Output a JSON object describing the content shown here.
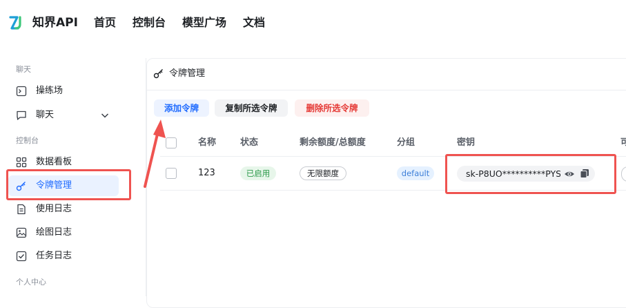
{
  "header": {
    "brand": "知界API",
    "nav": [
      "首页",
      "控制台",
      "模型广场",
      "文档"
    ]
  },
  "sidebar": {
    "sections": [
      {
        "label": "聊天"
      },
      {
        "label": "控制台"
      },
      {
        "label": "个人中心"
      }
    ],
    "items": [
      {
        "label": "操练场",
        "icon": "terminal-icon"
      },
      {
        "label": "聊天",
        "icon": "chat-icon"
      },
      {
        "label": "数据看板",
        "icon": "dashboard-icon"
      },
      {
        "label": "令牌管理",
        "icon": "key-icon",
        "active": true
      },
      {
        "label": "使用日志",
        "icon": "document-icon"
      },
      {
        "label": "绘图日志",
        "icon": "image-icon"
      },
      {
        "label": "任务日志",
        "icon": "task-check-icon"
      }
    ]
  },
  "page": {
    "title": "令牌管理",
    "actions": {
      "add": "添加令牌",
      "copy_selected": "复制所选令牌",
      "delete_selected": "删除所选令牌"
    },
    "columns": [
      "名称",
      "状态",
      "剩余额度/总额度",
      "分组",
      "密钥",
      "可"
    ],
    "rows": [
      {
        "name": "123",
        "status": "已启用",
        "quota": "无限额度",
        "group": "default",
        "key": "sk-P8UO**********PYS("
      }
    ]
  },
  "colors": {
    "accent": "#1f6bff",
    "danger": "#e53935",
    "annotation": "#ef5350",
    "enabled": "#2e9b4c"
  }
}
